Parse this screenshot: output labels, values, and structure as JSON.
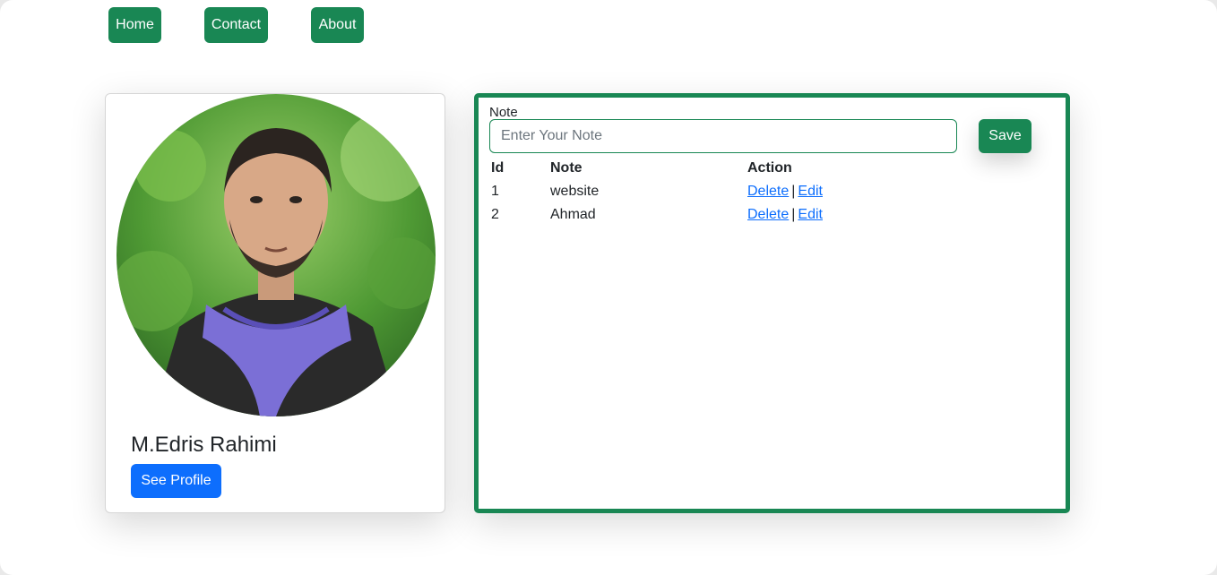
{
  "nav": {
    "home": "Home",
    "contact": "Contact",
    "about": "About"
  },
  "profile": {
    "name": "M.Edris Rahimi",
    "button": "See Profile"
  },
  "notes": {
    "label": "Note",
    "input_placeholder": "Enter Your Note",
    "input_value": "",
    "save_label": "Save",
    "headers": {
      "id": "Id",
      "note": "Note",
      "action": "Action"
    },
    "rows": [
      {
        "id": "1",
        "note": "website",
        "delete": "Delete",
        "edit": "Edit"
      },
      {
        "id": "2",
        "note": "Ahmad",
        "delete": "Delete",
        "edit": "Edit"
      }
    ],
    "separator": "|"
  },
  "colors": {
    "accent_green": "#198754",
    "primary_blue": "#0d6efd"
  }
}
